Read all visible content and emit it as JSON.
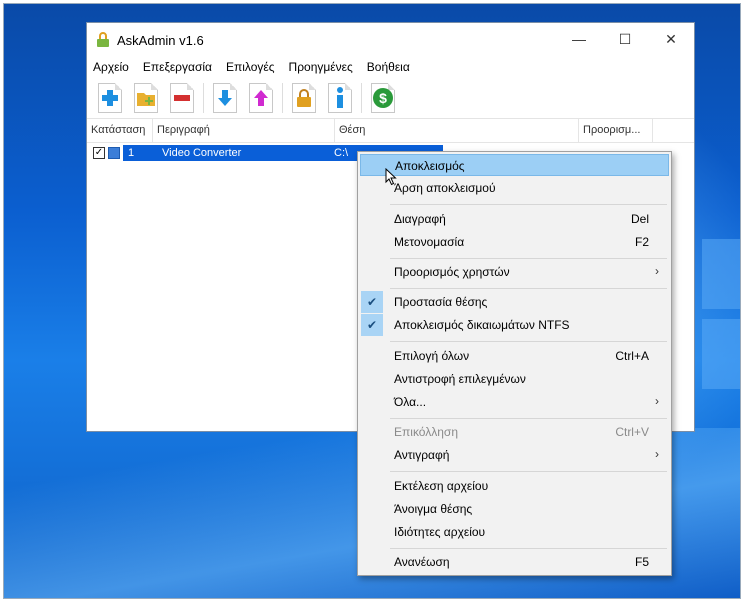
{
  "window": {
    "title": "AskAdmin v1.6",
    "minimize_glyph": "—",
    "maximize_glyph": "☐",
    "close_glyph": "✕"
  },
  "menubar": [
    "Αρχείο",
    "Επεξεργασία",
    "Επιλογές",
    "Προηγμένες",
    "Βοήθεια"
  ],
  "toolbar": {
    "buttons": [
      {
        "icon": "add-icon",
        "color": "#1d8fe0"
      },
      {
        "icon": "add-folder-icon",
        "color": "#e8b030"
      },
      {
        "icon": "remove-icon",
        "color": "#d43030"
      },
      {
        "icon": "arrow-down-icon",
        "color": "#1d8fe0"
      },
      {
        "icon": "arrow-up-icon",
        "color": "#d02ad0"
      },
      {
        "icon": "lock-icon",
        "color": "#e0a020"
      },
      {
        "icon": "info-icon",
        "color": "#1d8fe0"
      },
      {
        "icon": "dollar-icon",
        "color": "#2a9a3a"
      }
    ]
  },
  "list": {
    "columns": [
      "Κατάσταση",
      "Περιγραφή",
      "Θέση",
      "Προορισμ..."
    ],
    "row": {
      "number": "1",
      "description": "Video Converter",
      "location": "C:\\"
    }
  },
  "context_menu": {
    "items": [
      {
        "label": "Αποκλεισμός",
        "shortcut": "",
        "state": "hover"
      },
      {
        "label": "Άρση αποκλεισμού",
        "shortcut": ""
      },
      {
        "label": "Διαγραφή",
        "shortcut": "Del"
      },
      {
        "label": "Μετονομασία",
        "shortcut": "F2"
      },
      {
        "label": "Προορισμός χρηστών",
        "shortcut": "",
        "submenu": true
      },
      {
        "label": "Προστασία θέσης",
        "shortcut": "",
        "checked": true
      },
      {
        "label": "Αποκλεισμός δικαιωμάτων NTFS",
        "shortcut": "",
        "checked": true
      },
      {
        "label": "Επιλογή όλων",
        "shortcut": "Ctrl+A"
      },
      {
        "label": "Αντιστροφή επιλεγμένων",
        "shortcut": ""
      },
      {
        "label": "Όλα...",
        "shortcut": "",
        "submenu": true
      },
      {
        "label": "Επικόλληση",
        "shortcut": "Ctrl+V",
        "disabled": true
      },
      {
        "label": "Αντιγραφή",
        "shortcut": "",
        "submenu": true
      },
      {
        "label": "Εκτέλεση αρχείου",
        "shortcut": ""
      },
      {
        "label": "Άνοιγμα θέσης",
        "shortcut": ""
      },
      {
        "label": "Ιδιότητες αρχείου",
        "shortcut": ""
      },
      {
        "label": "Ανανέωση",
        "shortcut": "F5"
      }
    ],
    "checkmark": "✔",
    "submenu_arrow": "›"
  },
  "colors": {
    "selection": "#0a5fd8",
    "menu_hover": "#9ccff5",
    "desktop": "#0b5fd0"
  }
}
